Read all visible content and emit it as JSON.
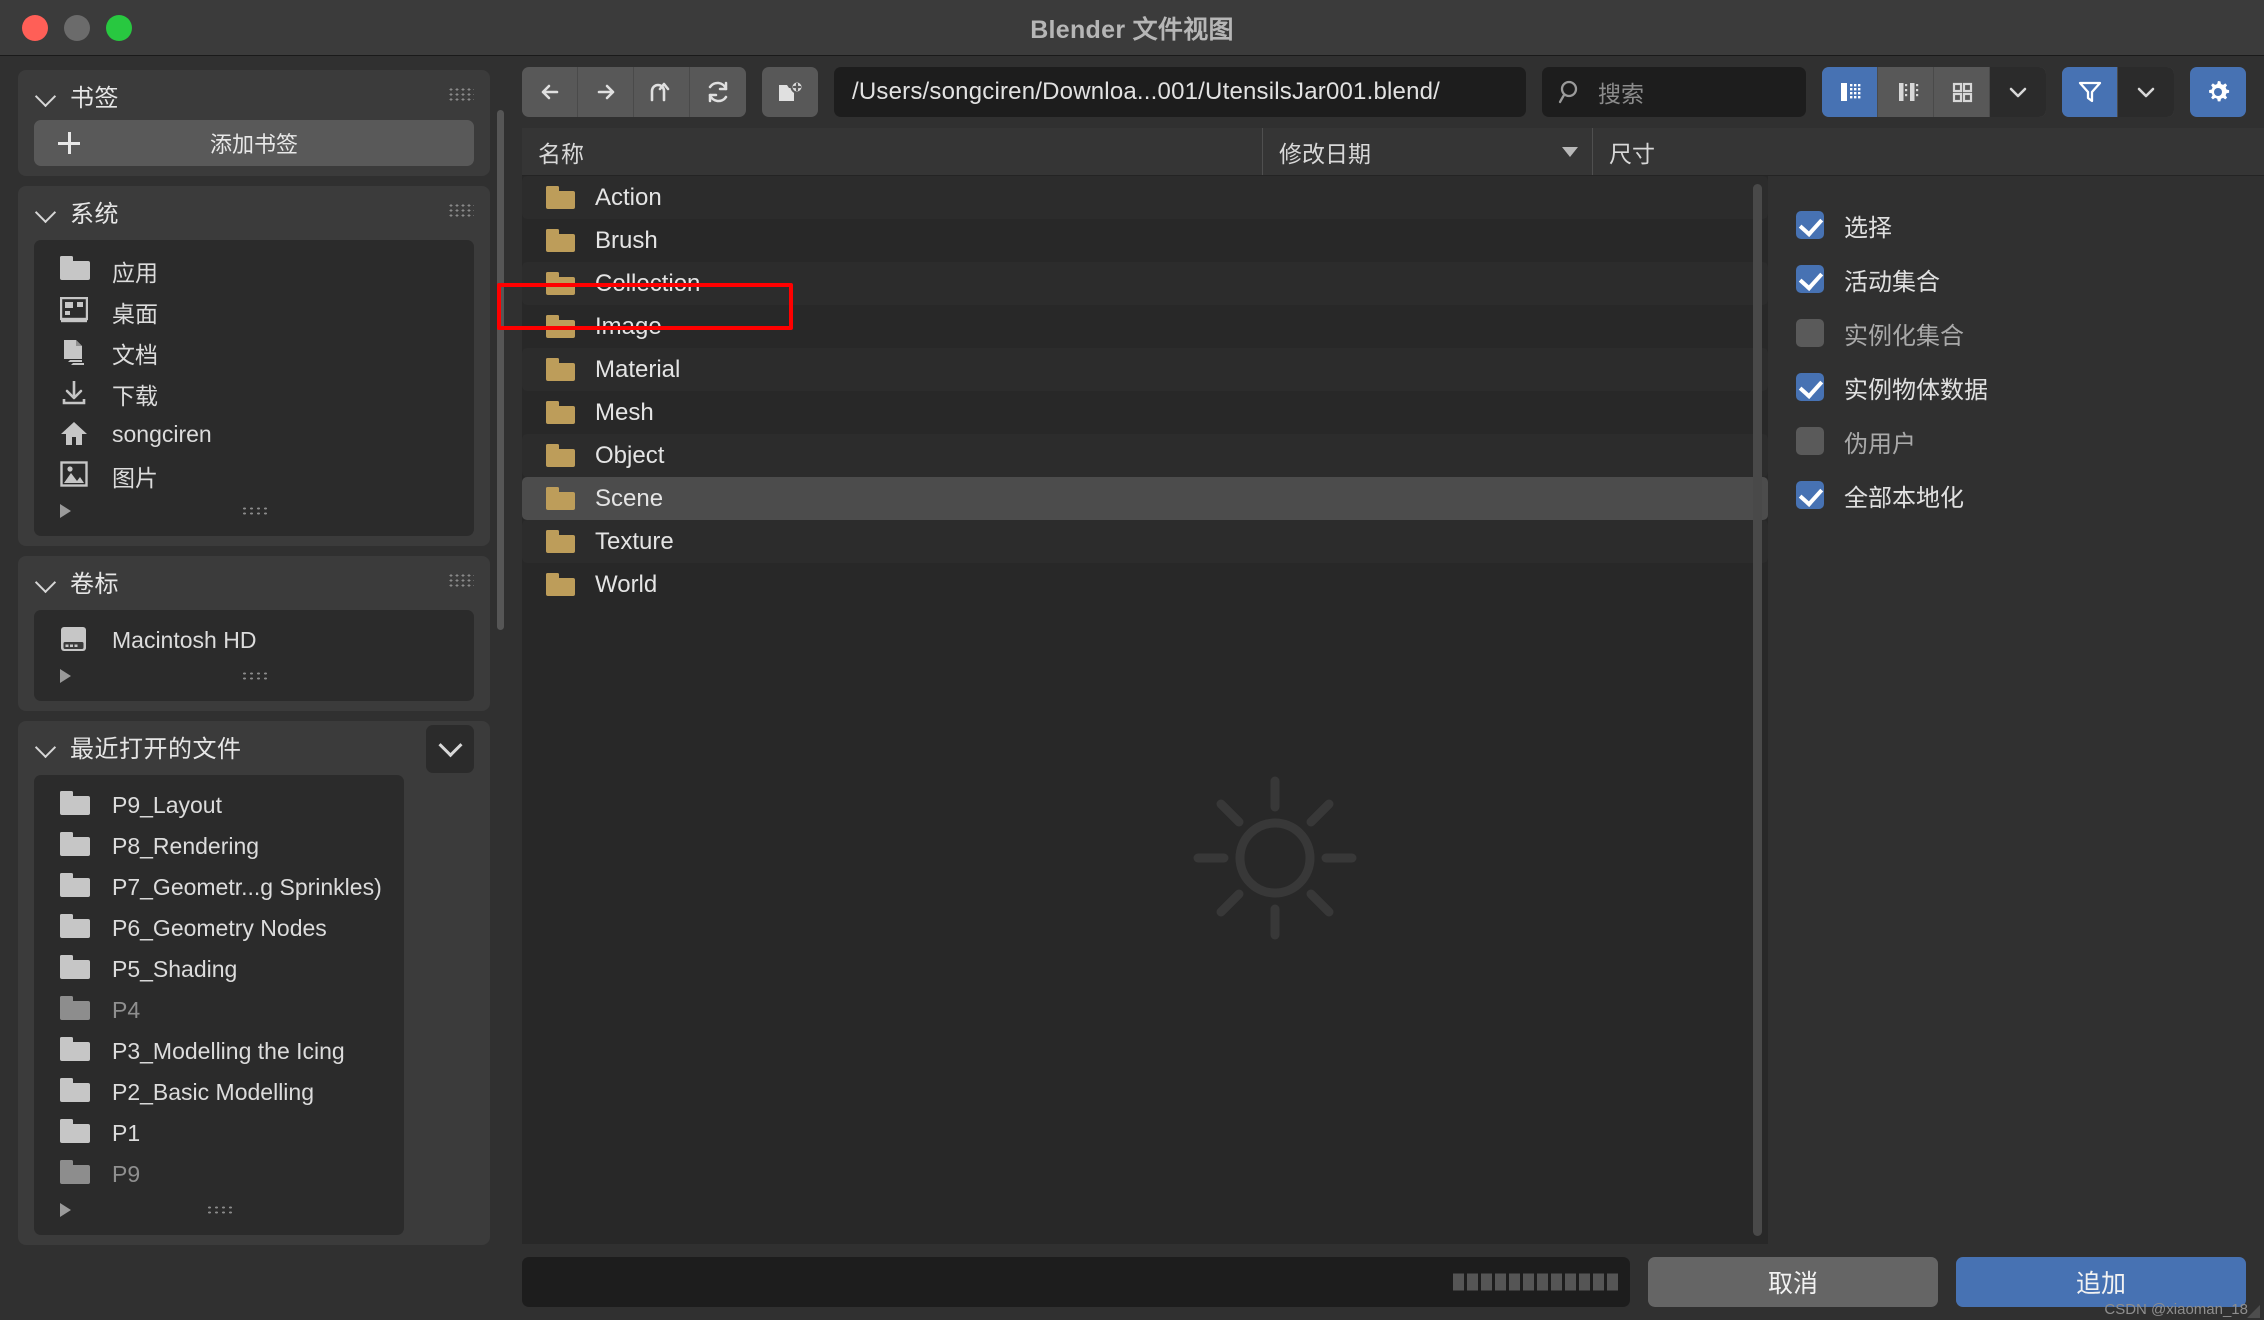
{
  "window": {
    "title": "Blender 文件视图",
    "traffic": {
      "close": "close",
      "minimize": "minimize",
      "zoom": "zoom"
    }
  },
  "sidebar": {
    "bookmarks": {
      "title": "书签",
      "add_label": "添加书签"
    },
    "system": {
      "title": "系统",
      "items": [
        {
          "label": "应用",
          "icon": "folder-icon",
          "dim": false
        },
        {
          "label": "桌面",
          "icon": "desktop-icon",
          "dim": false
        },
        {
          "label": "文档",
          "icon": "documents-icon",
          "dim": false
        },
        {
          "label": "下载",
          "icon": "download-icon",
          "dim": false
        },
        {
          "label": "songciren",
          "icon": "home-icon",
          "dim": false
        },
        {
          "label": "图片",
          "icon": "picture-icon",
          "dim": false
        }
      ]
    },
    "volumes": {
      "title": "卷标",
      "items": [
        {
          "label": "Macintosh HD",
          "icon": "disk-icon"
        }
      ]
    },
    "recent": {
      "title": "最近打开的文件",
      "items": [
        {
          "label": "P9_Layout",
          "dim": false
        },
        {
          "label": "P8_Rendering",
          "dim": false
        },
        {
          "label": "P7_Geometr...g Sprinkles)",
          "dim": false
        },
        {
          "label": "P6_Geometry Nodes",
          "dim": false
        },
        {
          "label": "P5_Shading",
          "dim": false
        },
        {
          "label": "P4",
          "dim": true
        },
        {
          "label": "P3_Modelling the Icing",
          "dim": false
        },
        {
          "label": "P2_Basic Modelling",
          "dim": false
        },
        {
          "label": "P1",
          "dim": false
        },
        {
          "label": "P9",
          "dim": true
        }
      ]
    }
  },
  "toolbar": {
    "back": "back-arrow-icon",
    "forward": "forward-arrow-icon",
    "up": "parent-directory-icon",
    "refresh": "refresh-icon",
    "new_folder": "new-folder-icon",
    "path_value": "/Users/songciren/Downloa...001/UtensilsJar001.blend/",
    "search_placeholder": "搜索",
    "view_modes": [
      "vertical-list-view",
      "horizontal-list-view",
      "thumbnail-view"
    ],
    "active_view_mode": 0,
    "display_dropdown": "chevron-down-icon",
    "filter_icon": "filter-funnel-icon",
    "filter_dropdown": "chevron-down-icon",
    "settings_icon": "gear-icon"
  },
  "columns": {
    "name": "名称",
    "date": "修改日期",
    "size": "尺寸",
    "sort_indicator": "sort-descending-icon"
  },
  "files": [
    {
      "name": "Action",
      "selected": false
    },
    {
      "name": "Brush",
      "selected": false
    },
    {
      "name": "Collection",
      "selected": false
    },
    {
      "name": "Image",
      "selected": false
    },
    {
      "name": "Material",
      "selected": false
    },
    {
      "name": "Mesh",
      "selected": false
    },
    {
      "name": "Object",
      "selected": false
    },
    {
      "name": "Scene",
      "selected": true
    },
    {
      "name": "Texture",
      "selected": false
    },
    {
      "name": "World",
      "selected": false
    }
  ],
  "options": [
    {
      "label": "选择",
      "checked": true
    },
    {
      "label": "活动集合",
      "checked": true
    },
    {
      "label": "实例化集合",
      "checked": false
    },
    {
      "label": "实例物体数据",
      "checked": true
    },
    {
      "label": "伪用户",
      "checked": false
    },
    {
      "label": "全部本地化",
      "checked": true
    }
  ],
  "footer": {
    "filename_value": "",
    "cancel_label": "取消",
    "append_label": "追加"
  },
  "watermark": "CSDN @xiaoman_18",
  "colors": {
    "accent_blue": "#4772b3",
    "folder_gold": "#bd9d5a",
    "annotation_red": "#ff0000",
    "panel_bg": "#3b3b3b",
    "list_bg": "#282828"
  }
}
